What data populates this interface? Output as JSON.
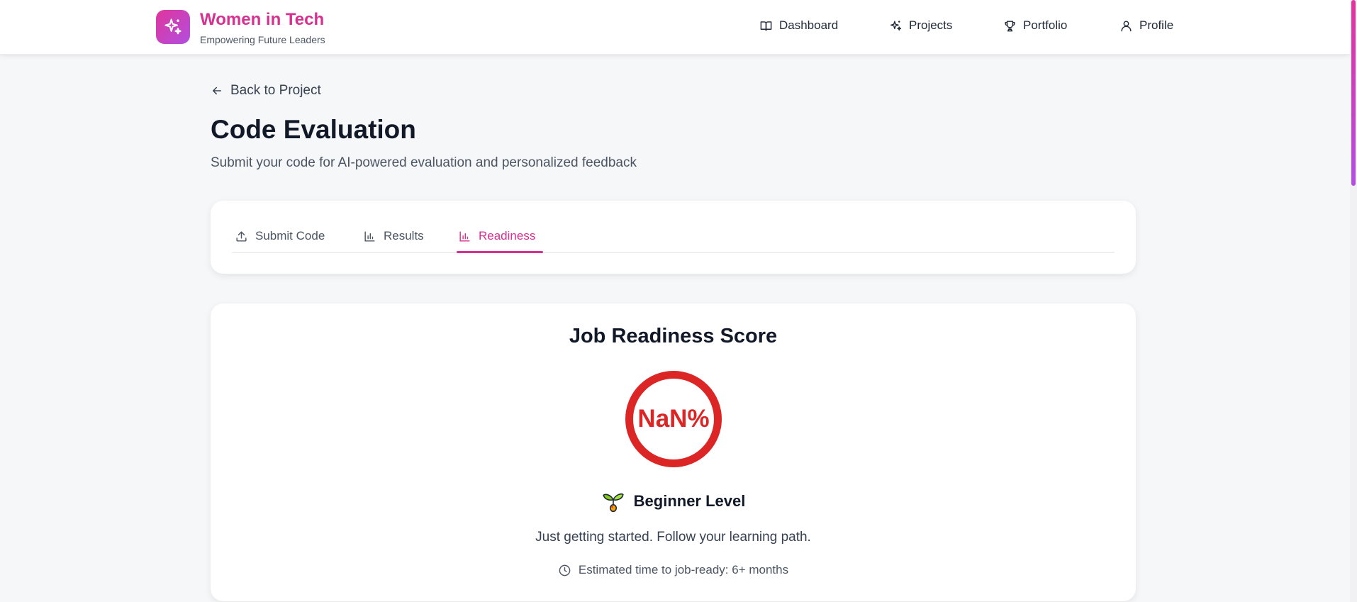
{
  "header": {
    "brand_title": "Women in Tech",
    "brand_subtitle": "Empowering Future Leaders",
    "logo_icon": "sparkles-icon",
    "nav": [
      {
        "label": "Dashboard",
        "icon": "book-open-icon"
      },
      {
        "label": "Projects",
        "icon": "sparkles-icon"
      },
      {
        "label": "Portfolio",
        "icon": "trophy-icon"
      },
      {
        "label": "Profile",
        "icon": "user-icon"
      }
    ]
  },
  "page": {
    "back_label": "Back to Project",
    "title": "Code Evaluation",
    "subtitle": "Submit your code for AI-powered evaluation and personalized feedback"
  },
  "tabs": [
    {
      "label": "Submit Code",
      "icon": "upload-icon",
      "active": false
    },
    {
      "label": "Results",
      "icon": "bar-chart-icon",
      "active": false
    },
    {
      "label": "Readiness",
      "icon": "bar-chart-icon",
      "active": true
    }
  ],
  "readiness": {
    "title": "Job Readiness Score",
    "score_display": "NaN%",
    "level_icon": "seedling-icon",
    "level_label": "Beginner Level",
    "description": "Just getting started. Follow your learning path.",
    "estimate": "Estimated time to job-ready: 6+ months"
  },
  "colors": {
    "accent": "#d63090",
    "accent_gradient_end": "#b14fe0",
    "score_ring": "#dc2626"
  }
}
